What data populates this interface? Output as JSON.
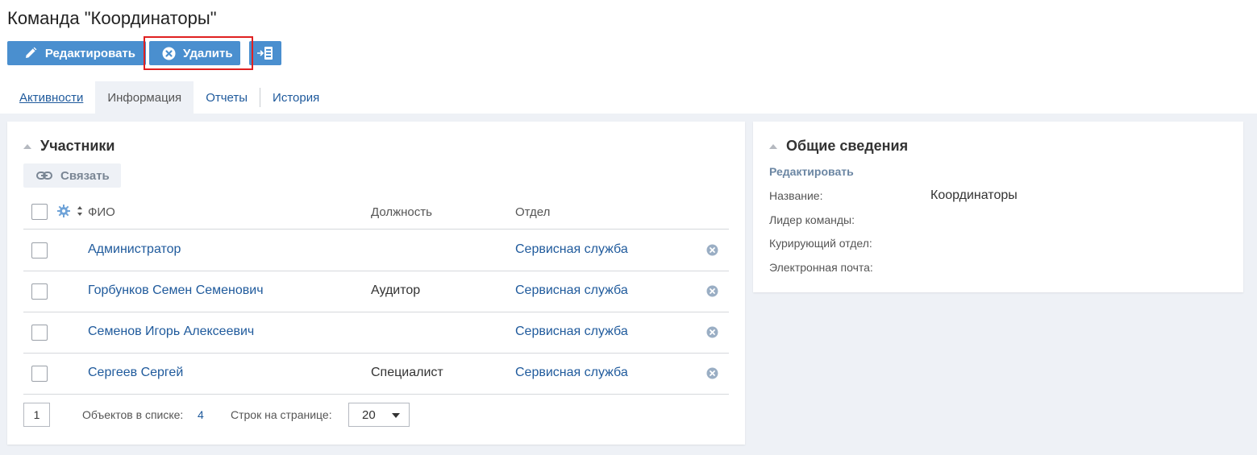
{
  "page": {
    "title": "Команда \"Координаторы\""
  },
  "toolbar": {
    "edit_label": "Редактировать",
    "delete_label": "Удалить",
    "accent": "#4a8fcf",
    "highlight_color": "#e02020"
  },
  "tabs": [
    {
      "label": "Активности",
      "active": false
    },
    {
      "label": "Информация",
      "active": true
    },
    {
      "label": "Отчеты",
      "active": false
    },
    {
      "label": "История",
      "active": false
    }
  ],
  "members": {
    "title": "Участники",
    "link_label": "Связать",
    "columns": {
      "name": "ФИО",
      "position": "Должность",
      "department": "Отдел"
    },
    "rows": [
      {
        "name": "Администратор",
        "position": "",
        "department": "Сервисная служба"
      },
      {
        "name": "Горбунков Семен Семенович",
        "position": "Аудитор",
        "department": "Сервисная служба"
      },
      {
        "name": "Семенов Игорь Алексеевич",
        "position": "",
        "department": "Сервисная служба"
      },
      {
        "name": "Сергеев Сергей",
        "position": "Специалист",
        "department": "Сервисная служба"
      }
    ],
    "pager": {
      "page": "1",
      "count_label": "Объектов в списке:",
      "count": "4",
      "rows_label": "Строк на странице:",
      "rows_per_page": "20"
    }
  },
  "general": {
    "title": "Общие сведения",
    "edit_label": "Редактировать",
    "fields": [
      {
        "label": "Название:",
        "value": "Координаторы"
      },
      {
        "label": "Лидер команды:",
        "value": ""
      },
      {
        "label": "Курирующий отдел:",
        "value": ""
      },
      {
        "label": "Электронная почта:",
        "value": ""
      }
    ]
  }
}
